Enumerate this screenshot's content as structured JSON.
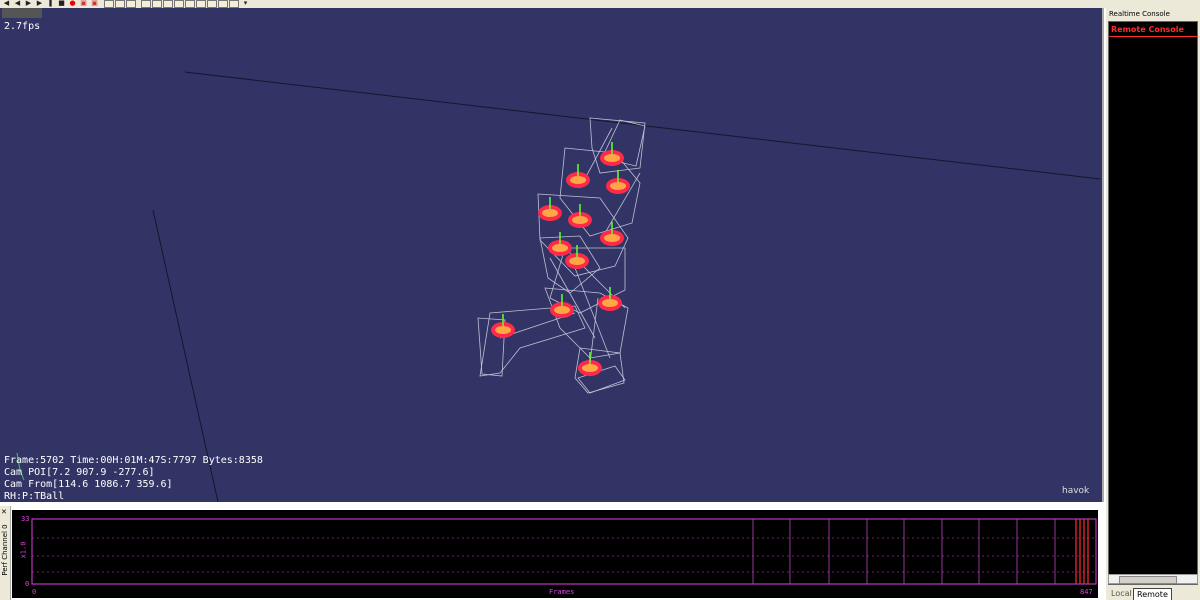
{
  "viewport": {
    "fps": "2.7fps",
    "hud": {
      "frame_line": "Frame:5702 Time:00H:01M:47S:7797 Bytes:8358",
      "cam_poi": "Cam POI[7.2 907.9 -277.6]",
      "cam_from": "Cam From[114.6 1086.7 359.6]",
      "rh": "RH:P:TBall"
    },
    "logo": "havok"
  },
  "perf": {
    "title": "Perf Channel 0",
    "y_max": "33",
    "y_min": "0",
    "multiplier": "x1.0",
    "x_start": "0",
    "x_label": "Frames",
    "x_end": "847"
  },
  "console": {
    "title": "Realtime Console",
    "header": "Remote Console",
    "tabs": [
      "Local",
      "Remote"
    ]
  },
  "colors": {
    "viewport_bg": "#333466",
    "accent_red": "#ff2d2d",
    "perf_magenta": "#e040e0"
  }
}
